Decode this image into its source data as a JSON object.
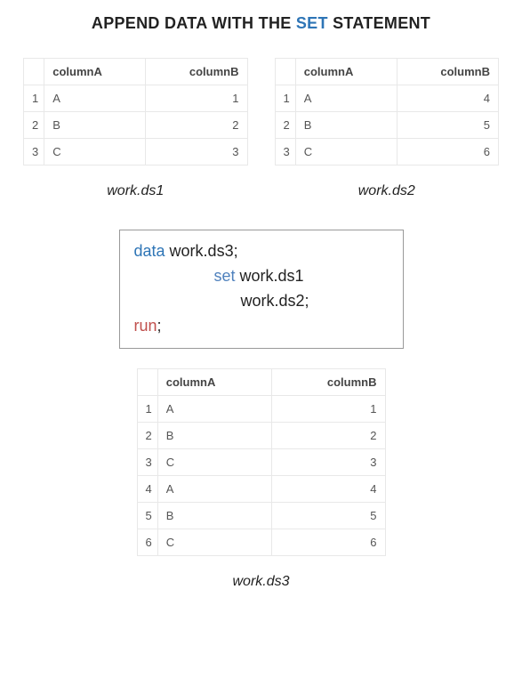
{
  "title": {
    "prefix": "APPEND DATA WITH THE ",
    "keyword": "SET",
    "suffix": " STATEMENT"
  },
  "headers": {
    "colA": "columnA",
    "colB": "columnB"
  },
  "ds1": {
    "label": "work.ds1",
    "rows": [
      {
        "n": "1",
        "a": "A",
        "b": "1"
      },
      {
        "n": "2",
        "a": "B",
        "b": "2"
      },
      {
        "n": "3",
        "a": "C",
        "b": "3"
      }
    ]
  },
  "ds2": {
    "label": "work.ds2",
    "rows": [
      {
        "n": "1",
        "a": "A",
        "b": "4"
      },
      {
        "n": "2",
        "a": "B",
        "b": "5"
      },
      {
        "n": "3",
        "a": "C",
        "b": "6"
      }
    ]
  },
  "ds3": {
    "label": "work.ds3",
    "rows": [
      {
        "n": "1",
        "a": "A",
        "b": "1"
      },
      {
        "n": "2",
        "a": "B",
        "b": "2"
      },
      {
        "n": "3",
        "a": "C",
        "b": "3"
      },
      {
        "n": "4",
        "a": "A",
        "b": "4"
      },
      {
        "n": "5",
        "a": "B",
        "b": "5"
      },
      {
        "n": "6",
        "a": "C",
        "b": "6"
      }
    ]
  },
  "code": {
    "kw_data": "data",
    "line1_rest": " work.ds3;",
    "kw_set": "set",
    "line2_rest": " work.ds1",
    "line3": "work.ds2;",
    "kw_run": "run",
    "line4_rest": ";"
  }
}
